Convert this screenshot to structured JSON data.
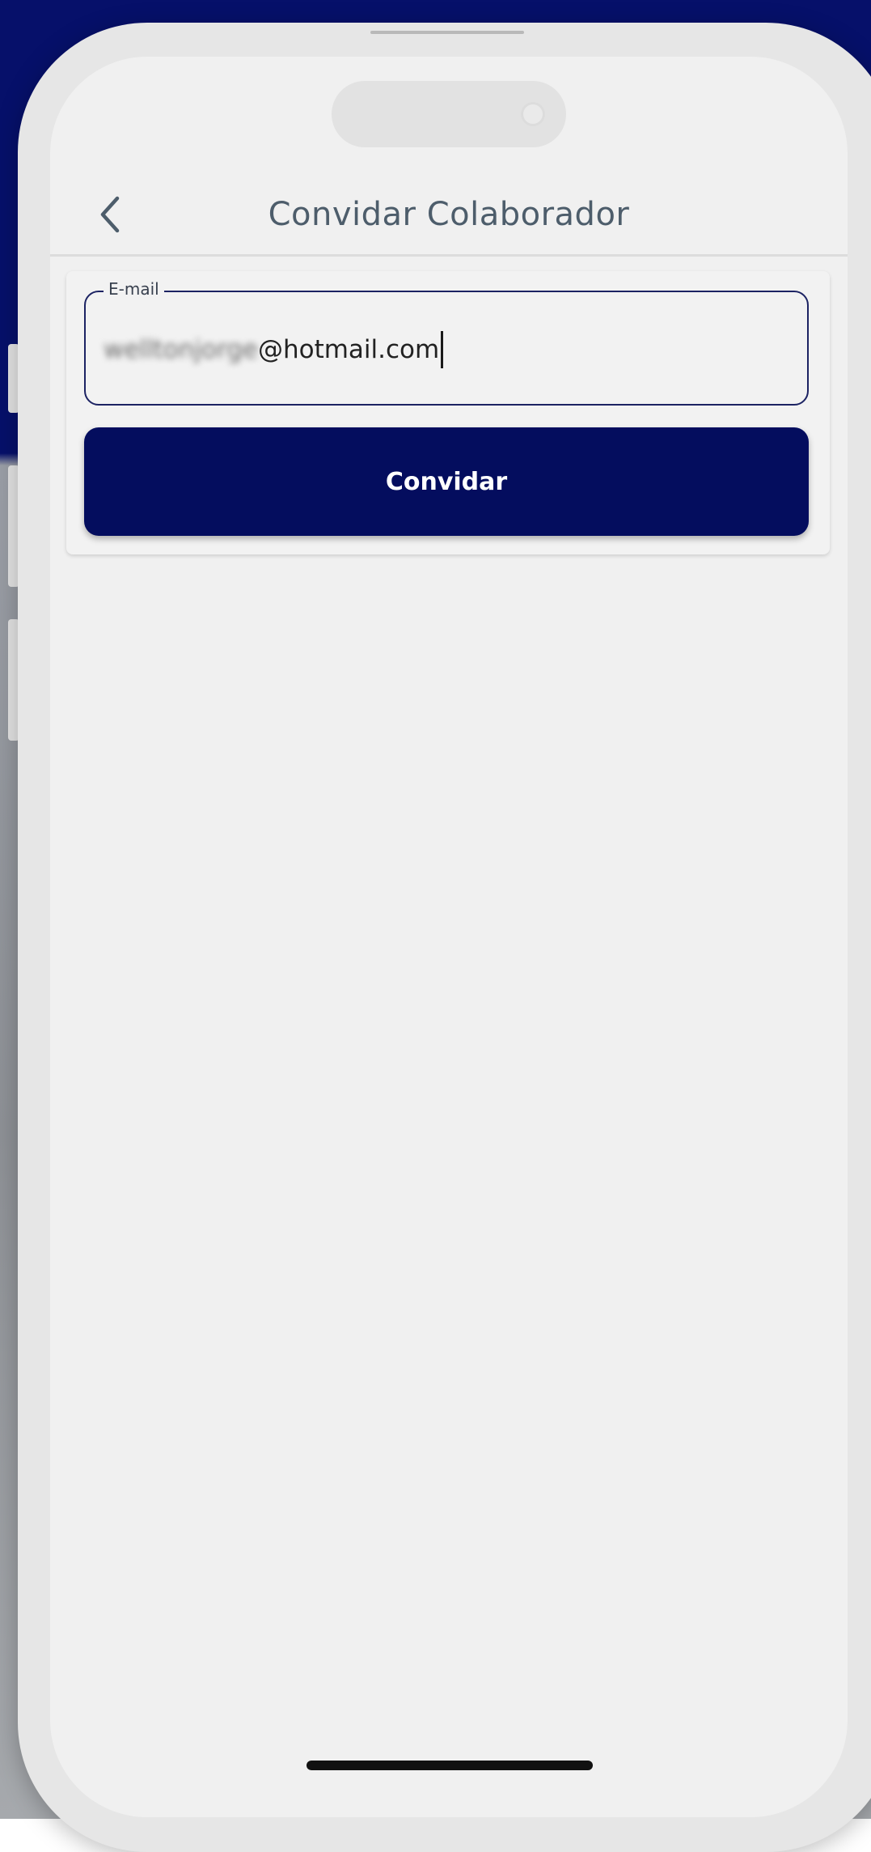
{
  "header": {
    "title": "Convidar Colaborador",
    "back_icon": "chevron-left-icon"
  },
  "form": {
    "email_label": "E-mail",
    "email_value_hidden": "welltonjorge",
    "email_value_visible": "@hotmail.com",
    "invite_label": "Convidar"
  },
  "colors": {
    "primary": "#040d5e",
    "title_text": "#4d5d6b",
    "screen_bg": "#f0f0f0"
  }
}
